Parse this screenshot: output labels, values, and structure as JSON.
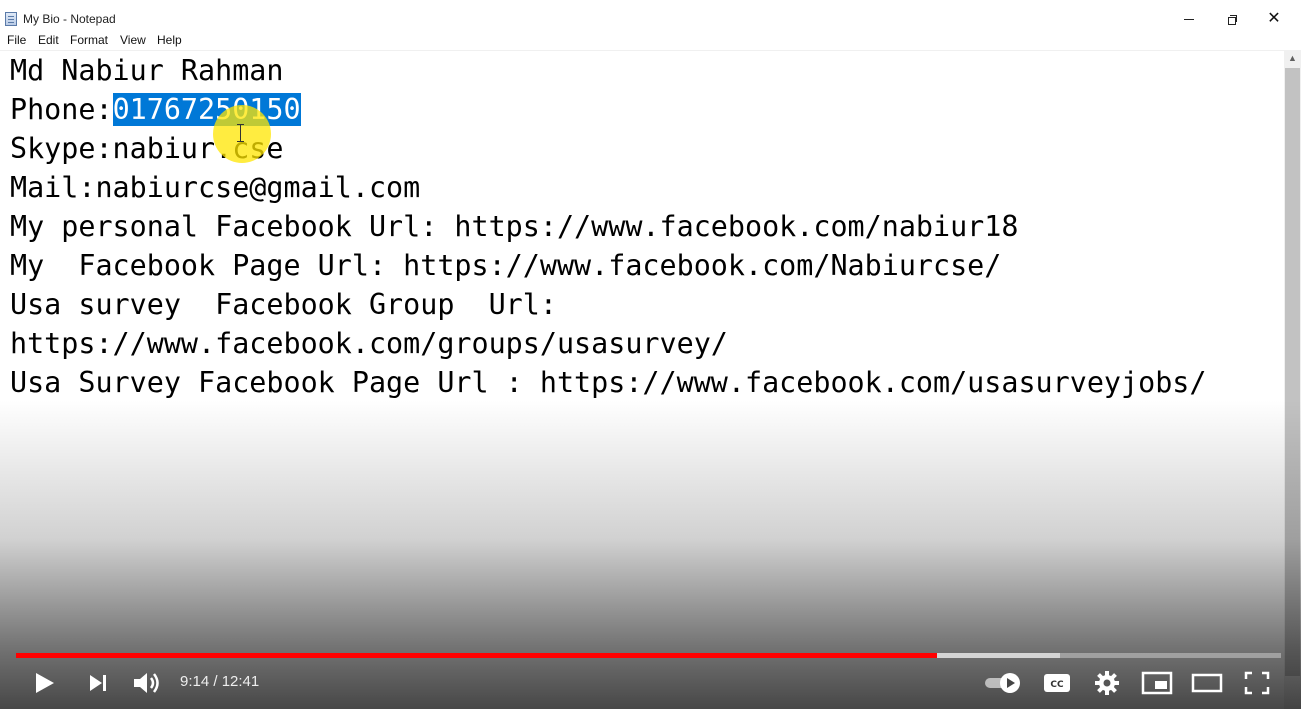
{
  "window": {
    "title": "My Bio - Notepad",
    "minimize_icon": "minimize-icon",
    "restore_icon": "restore-icon",
    "close_icon": "close-icon"
  },
  "menu": {
    "items": [
      "File",
      "Edit",
      "Format",
      "View",
      "Help"
    ]
  },
  "editor": {
    "lines": [
      "Md Nabiur Rahman",
      "Phone:",
      "Skype:nabiur.cse",
      "Mail:nabiurcse@gmail.com",
      "My personal Facebook Url: https://www.facebook.com/nabiur18",
      "My  Facebook Page Url: https://www.facebook.com/Nabiurcse/",
      "Usa survey  Facebook Group  Url:",
      "https://www.facebook.com/groups/usasurvey/",
      "Usa Survey Facebook Page Url : https://www.facebook.com/usasurveyjobs/"
    ],
    "selected_text": "01767250150",
    "selection_color": "#0078d7"
  },
  "player": {
    "time_display": "9:14 / 12:41",
    "progress_played": 0.728,
    "progress_buffered": 0.825,
    "progress_color": "#ff0000",
    "icons": [
      "play-icon",
      "next-icon",
      "volume-icon",
      "autoplay-toggle-icon",
      "captions-icon",
      "settings-icon",
      "miniplayer-icon",
      "theater-mode-icon",
      "fullscreen-icon"
    ]
  }
}
